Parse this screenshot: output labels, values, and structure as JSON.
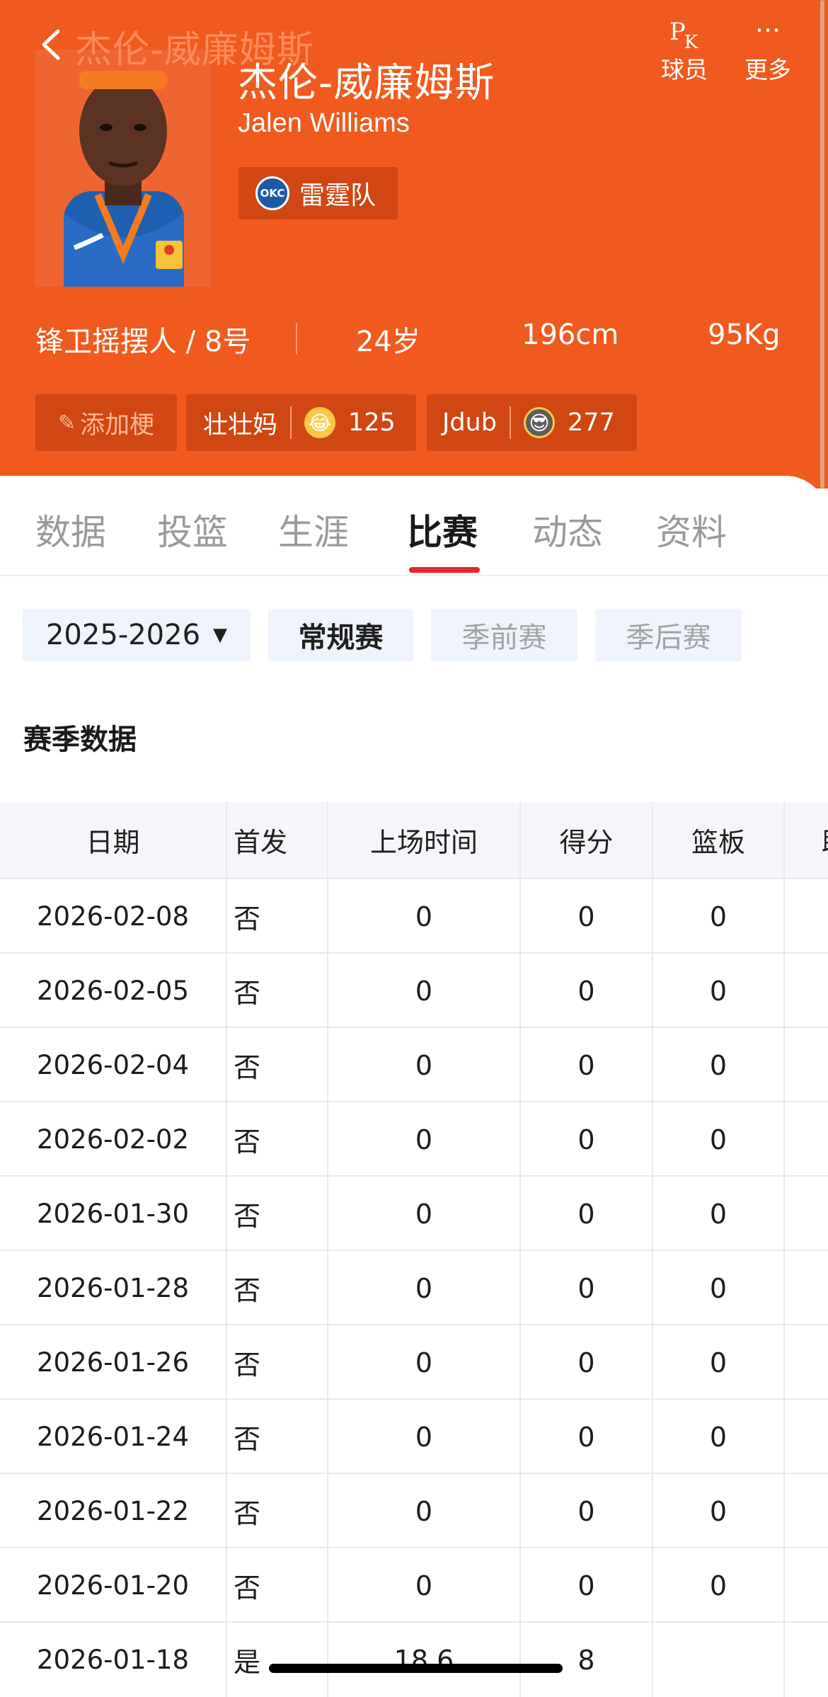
{
  "header": {
    "nav_title": "杰伦-威廉姆斯",
    "pk_label": "球员",
    "more_label": "更多"
  },
  "player": {
    "name_cn": "杰伦-威廉姆斯",
    "name_en": "Jalen Williams",
    "team": "雷霆队",
    "team_logo_text": "OKC",
    "position_number": "锋卫摇摆人 / 8号",
    "age": "24岁",
    "height": "196cm",
    "weight": "95Kg"
  },
  "tags": {
    "add_label": "添加梗",
    "items": [
      {
        "text": "壮壮妈",
        "count": "125",
        "emoji": "laugh-cry"
      },
      {
        "text": "Jdub",
        "count": "277",
        "emoji": "cool-face"
      }
    ]
  },
  "tabs": [
    "数据",
    "投篮",
    "生涯",
    "比赛",
    "动态",
    "资料"
  ],
  "active_tab": "比赛",
  "filters": {
    "season": "2025-2026",
    "regular": "常规赛",
    "preseason": "季前赛",
    "postseason": "季后赛"
  },
  "section_title": "赛季数据",
  "table": {
    "headers": [
      "日期",
      "首发",
      "上场时间",
      "得分",
      "篮板",
      "助"
    ],
    "rows": [
      [
        "2026-02-08",
        "否",
        "0",
        "0",
        "0"
      ],
      [
        "2026-02-05",
        "否",
        "0",
        "0",
        "0"
      ],
      [
        "2026-02-04",
        "否",
        "0",
        "0",
        "0"
      ],
      [
        "2026-02-02",
        "否",
        "0",
        "0",
        "0"
      ],
      [
        "2026-01-30",
        "否",
        "0",
        "0",
        "0"
      ],
      [
        "2026-01-28",
        "否",
        "0",
        "0",
        "0"
      ],
      [
        "2026-01-26",
        "否",
        "0",
        "0",
        "0"
      ],
      [
        "2026-01-24",
        "否",
        "0",
        "0",
        "0"
      ],
      [
        "2026-01-22",
        "否",
        "0",
        "0",
        "0"
      ],
      [
        "2026-01-20",
        "否",
        "0",
        "0",
        "0"
      ],
      [
        "2026-01-18",
        "是",
        "18.6",
        "8",
        ""
      ]
    ]
  },
  "colors": {
    "header_bg": "#f05a1e",
    "chip_bg": "#d04714",
    "tab_active_underline": "#e8232d",
    "filter_bg": "#eef3fc"
  }
}
